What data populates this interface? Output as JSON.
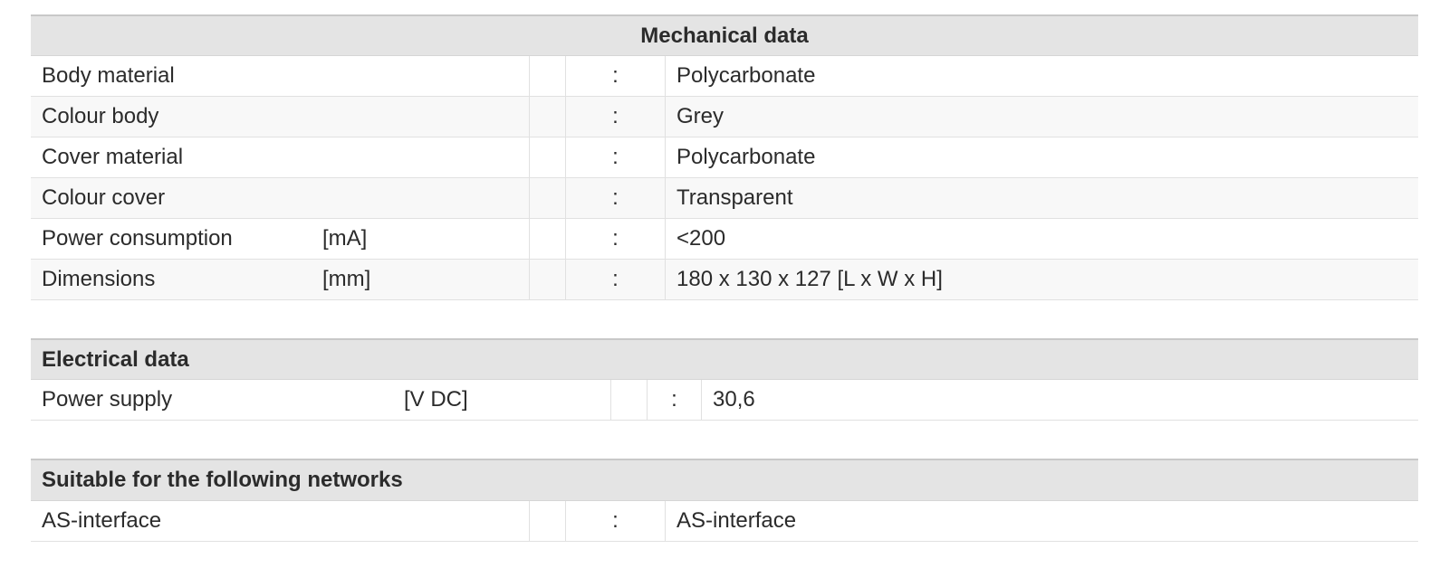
{
  "colon": ":",
  "sections": [
    {
      "title": "Mechanical data",
      "align": "center",
      "rows": [
        {
          "label": "Body material",
          "unit": "",
          "value": "Polycarbonate"
        },
        {
          "label": "Colour body",
          "unit": "",
          "value": "Grey"
        },
        {
          "label": "Cover material",
          "unit": "",
          "value": "Polycarbonate"
        },
        {
          "label": "Colour cover",
          "unit": "",
          "value": "Transparent"
        },
        {
          "label": "Power consumption",
          "unit": "[mA]",
          "value": "<200"
        },
        {
          "label": "Dimensions",
          "unit": "[mm]",
          "value": "180 x 130 x 127  [L x W x H]"
        }
      ]
    },
    {
      "title": "Electrical data",
      "align": "left",
      "rows": [
        {
          "label": "Power supply",
          "unit": "[V DC]",
          "value": "30,6"
        }
      ]
    },
    {
      "title": "Suitable for the following networks",
      "align": "left",
      "rows": [
        {
          "label": "AS-interface",
          "unit": "",
          "value": "AS-interface"
        }
      ]
    }
  ]
}
